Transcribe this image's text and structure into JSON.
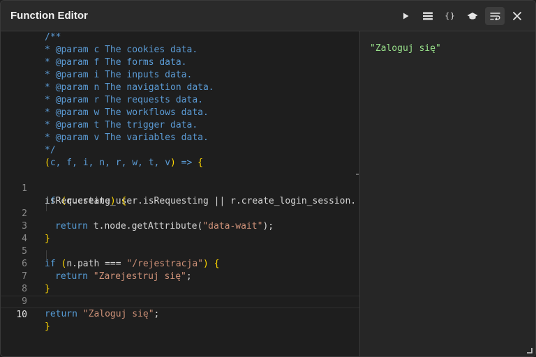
{
  "window": {
    "title": "Function Editor"
  },
  "toolbar": {
    "run_icon": "play-icon",
    "list_icon": "list-icon",
    "format_label": "{}",
    "hat_icon": "graduation-cap-icon",
    "wrap_icon": "wrap-text-icon",
    "close_icon": "close-icon"
  },
  "editor": {
    "header_lines": [
      "/**",
      "* @param c The cookies data.",
      "* @param f The forms data.",
      "* @param i The inputs data.",
      "* @param n The navigation data.",
      "* @param r The requests data.",
      "* @param w The workflows data.",
      "* @param t The trigger data.",
      "* @param v The variables data.",
      "*/"
    ],
    "signature": {
      "params": "c, f, i, n, r, w, t, v",
      "arrow": " => "
    },
    "line_numbers": [
      "1",
      "2",
      "3",
      "4",
      "5",
      "6",
      "7",
      "8",
      "9",
      "10"
    ],
    "code": {
      "l1_kw": "if",
      "l1_cond": "r.create_user.isRequesting || r.create_login_session.",
      "l1b_cond": "isRequesting",
      "l2_kw": "return",
      "l2_expr": " t.node.getAttribute(",
      "l2_str": "\"data-wait\"",
      "l2_end": ");",
      "l5_kw": "if",
      "l5_cond": "n.path === ",
      "l5_str": "\"/rejestracja\"",
      "l6_kw": "return",
      "l6_str": "\"Zarejestruj się\"",
      "l6_end": ";",
      "l9_kw": "return",
      "l9_str": "\"Zaloguj się\"",
      "l9_end": ";"
    }
  },
  "output": {
    "result": "\"Zaloguj się\""
  },
  "colors": {
    "comment": "#5b9bd5",
    "keyword": "#569cd6",
    "string": "#ce9178",
    "bracket": "#ffd700",
    "result": "#98e08a"
  }
}
